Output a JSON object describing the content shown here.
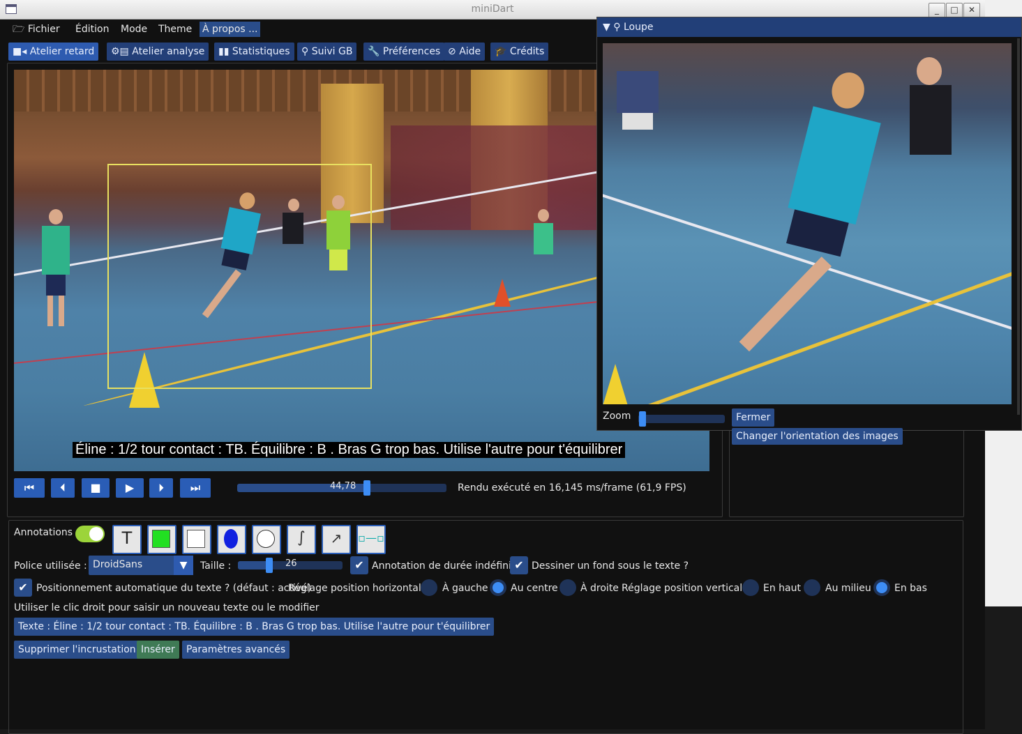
{
  "window": {
    "title": "miniDart"
  },
  "menubar": {
    "items": [
      "Fichier",
      "Édition",
      "Mode",
      "Theme",
      "À propos ..."
    ]
  },
  "tabs": [
    "Atelier retard",
    "Atelier analyse",
    "Statistiques",
    "Suivi GB",
    "Préférences",
    "Aide",
    "Crédits"
  ],
  "video": {
    "overlay_text": "Éline : 1/2 tour contact : TB. Équilibre : B . Bras  G trop bas. Utilise l'autre  pour t'équilibrer",
    "position_label": "44,78",
    "position_fraction": 0.62,
    "render_info": "Rendu exécuté en 16,145 ms/frame (61,9 FPS)"
  },
  "loupe": {
    "title": "Loupe",
    "zoom_label": "Zoom",
    "zoom_fraction": 0.05,
    "close_label": "Fermer",
    "orientation_label": "Changer l'orientation des images"
  },
  "annotations": {
    "label": "Annotations",
    "enabled": true,
    "font_label": "Police utilisée :",
    "font_value": "DroidSans",
    "size_label": "Taille :",
    "size_value": "26",
    "size_fraction": 0.3,
    "indefinite_label": "Annotation de durée indéfinie",
    "background_label": "Dessiner un fond sous le texte ?",
    "auto_position_label": "Positionnement automatique du texte ? (défaut : activé)",
    "horizontal_label": "Réglage position horizontale",
    "h_left": "À gauche",
    "h_center": "Au centre",
    "h_right": "À droite",
    "vertical_label": "Réglage position verticale",
    "v_top": "En haut",
    "v_middle": "Au milieu",
    "v_bottom": "En bas",
    "hint": "Utiliser le clic droit pour saisir un nouveau texte ou le modifier",
    "text_button": "Texte : Éline : 1/2 tour contact : TB. Équilibre : B . Bras  G trop bas. Utilise l'autre  pour t'équilibrer",
    "delete_button": "Supprimer l'incrustation",
    "insert_button": "Insérer",
    "advanced_button": "Paramètres avancés"
  },
  "colors": {
    "accent": "#2a5db6",
    "panel": "#111111",
    "tab": "#233f78",
    "insert": "#3f7a55",
    "selection_box": "#e8e060"
  }
}
